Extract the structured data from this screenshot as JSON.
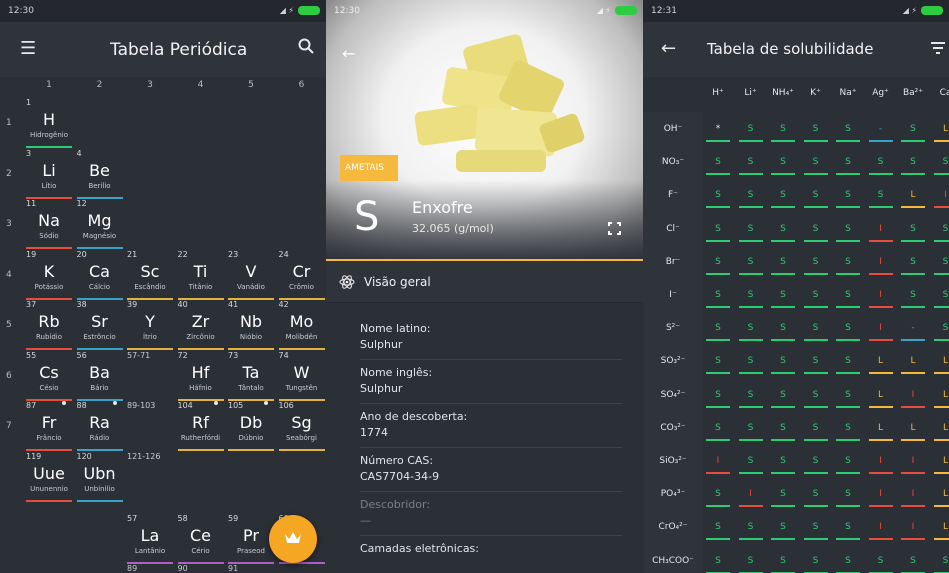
{
  "screen1": {
    "status": {
      "time": "12:30"
    },
    "appbar": {
      "title": "Tabela Periódica",
      "menu_icon": "menu-icon",
      "search_icon": "search-icon"
    },
    "columns": [
      "1",
      "2",
      "3",
      "4",
      "5",
      "6"
    ],
    "rows": [
      "1",
      "2",
      "3",
      "4",
      "5",
      "6",
      "7"
    ],
    "elements": [
      {
        "num": "1",
        "sym": "H",
        "name": "Hidrogênio",
        "col": 0,
        "row": 0,
        "color": "#2ecc71"
      },
      {
        "num": "3",
        "sym": "Li",
        "name": "Lítio",
        "col": 0,
        "row": 1,
        "color": "#e84c3d"
      },
      {
        "num": "4",
        "sym": "Be",
        "name": "Berílio",
        "col": 1,
        "row": 1,
        "color": "#3aa3c9"
      },
      {
        "num": "11",
        "sym": "Na",
        "name": "Sódio",
        "col": 0,
        "row": 2,
        "color": "#e84c3d"
      },
      {
        "num": "12",
        "sym": "Mg",
        "name": "Magnésio",
        "col": 1,
        "row": 2,
        "color": "#3aa3c9"
      },
      {
        "num": "19",
        "sym": "K",
        "name": "Potássio",
        "col": 0,
        "row": 3,
        "color": "#e84c3d"
      },
      {
        "num": "20",
        "sym": "Ca",
        "name": "Cálcio",
        "col": 1,
        "row": 3,
        "color": "#3aa3c9"
      },
      {
        "num": "21",
        "sym": "Sc",
        "name": "Escândio",
        "col": 2,
        "row": 3,
        "color": "#e3b341"
      },
      {
        "num": "22",
        "sym": "Ti",
        "name": "Titânio",
        "col": 3,
        "row": 3,
        "color": "#e3b341"
      },
      {
        "num": "23",
        "sym": "V",
        "name": "Vanádio",
        "col": 4,
        "row": 3,
        "color": "#e3b341"
      },
      {
        "num": "24",
        "sym": "Cr",
        "name": "Crômio",
        "col": 5,
        "row": 3,
        "color": "#e3b341"
      },
      {
        "num": "37",
        "sym": "Rb",
        "name": "Rubídio",
        "col": 0,
        "row": 4,
        "color": "#e84c3d"
      },
      {
        "num": "38",
        "sym": "Sr",
        "name": "Estrôncio",
        "col": 1,
        "row": 4,
        "color": "#3aa3c9"
      },
      {
        "num": "39",
        "sym": "Y",
        "name": "Ítrio",
        "col": 2,
        "row": 4,
        "color": "#e3b341"
      },
      {
        "num": "40",
        "sym": "Zr",
        "name": "Zircônio",
        "col": 3,
        "row": 4,
        "color": "#e3b341"
      },
      {
        "num": "41",
        "sym": "Nb",
        "name": "Nióbio",
        "col": 4,
        "row": 4,
        "color": "#e3b341"
      },
      {
        "num": "42",
        "sym": "Mo",
        "name": "Molibdên",
        "col": 5,
        "row": 4,
        "color": "#e3b341"
      },
      {
        "num": "55",
        "sym": "Cs",
        "name": "Césio",
        "col": 0,
        "row": 5,
        "color": "#e84c3d"
      },
      {
        "num": "56",
        "sym": "Ba",
        "name": "Bário",
        "col": 1,
        "row": 5,
        "color": "#3aa3c9"
      },
      {
        "num": "72",
        "sym": "Hf",
        "name": "Háfnio",
        "col": 3,
        "row": 5,
        "color": "#e3b341"
      },
      {
        "num": "73",
        "sym": "Ta",
        "name": "Tântalo",
        "col": 4,
        "row": 5,
        "color": "#e3b341"
      },
      {
        "num": "74",
        "sym": "W",
        "name": "Tungstên",
        "col": 5,
        "row": 5,
        "color": "#e3b341"
      },
      {
        "num": "87",
        "sym": "Fr",
        "name": "Frâncio",
        "col": 0,
        "row": 6,
        "color": "#e84c3d",
        "dot": true
      },
      {
        "num": "88",
        "sym": "Ra",
        "name": "Rádio",
        "col": 1,
        "row": 6,
        "color": "#3aa3c9",
        "dot": true
      },
      {
        "num": "104",
        "sym": "Rf",
        "name": "Rutherfórdi",
        "col": 3,
        "row": 6,
        "color": "#e3b341",
        "dot": true
      },
      {
        "num": "105",
        "sym": "Db",
        "name": "Dúbnio",
        "col": 4,
        "row": 6,
        "color": "#e3b341",
        "dot": true
      },
      {
        "num": "106",
        "sym": "Sg",
        "name": "Seabórgi",
        "col": 5,
        "row": 6,
        "color": "#e3b341"
      },
      {
        "num": "119",
        "sym": "Uue",
        "name": "Ununennio",
        "col": 0,
        "row": 7,
        "color": "#e84c3d"
      },
      {
        "num": "120",
        "sym": "Ubn",
        "name": "Unbinilio",
        "col": 1,
        "row": 7,
        "color": "#3aa3c9"
      },
      {
        "num": "57",
        "sym": "La",
        "name": "Lantânio",
        "col": 2,
        "row": 8,
        "color": "#b05fc7"
      },
      {
        "num": "58",
        "sym": "Ce",
        "name": "Cério",
        "col": 3,
        "row": 8,
        "color": "#b05fc7"
      },
      {
        "num": "59",
        "sym": "Pr",
        "name": "Praseod",
        "col": 4,
        "row": 8,
        "color": "#b05fc7"
      },
      {
        "num": "60",
        "sym": "d",
        "name": "mi",
        "col": 5,
        "row": 8,
        "color": "#b05fc7"
      }
    ],
    "ranges": [
      {
        "text": "57-71",
        "col": 2,
        "row": 5
      },
      {
        "text": "89-103",
        "col": 2,
        "row": 6
      },
      {
        "text": "121-126",
        "col": 2,
        "row": 7
      }
    ],
    "bottom_nums": [
      "89",
      "90",
      "91"
    ],
    "fab_icon": "crown-icon"
  },
  "screen2": {
    "status": {
      "time": "12:30"
    },
    "back_icon": "back-arrow-icon",
    "badge": "AMETAIS",
    "symbol": "S",
    "name": "Enxofre",
    "mass": "32.065 (g/mol)",
    "expand_icon": "fullscreen-icon",
    "section": {
      "icon": "atom-icon",
      "label": "Visão geral"
    },
    "props": [
      {
        "k": "Nome latino:",
        "v": "Sulphur"
      },
      {
        "k": "Nome inglês:",
        "v": "Sulphur"
      },
      {
        "k": "Ano de descoberta:",
        "v": "1774"
      },
      {
        "k": "Número CAS:",
        "v": "CAS7704-34-9"
      },
      {
        "k": "Descobridor:",
        "v": "—",
        "muted": true
      },
      {
        "k": "Camadas eletrônicas:",
        "v": "",
        "muted": false
      }
    ],
    "colors": {
      "accent": "#f5b93d"
    }
  },
  "screen3": {
    "status": {
      "time": "12:31"
    },
    "appbar": {
      "title": "Tabela de solubilidade",
      "back_icon": "back-arrow-icon",
      "filter_icon": "filter-icon"
    },
    "cations": [
      "H⁺",
      "Li⁺",
      "NH₄⁺",
      "K⁺",
      "Na⁺",
      "Ag⁺",
      "Ba²⁺",
      "Ca"
    ],
    "anions": [
      "OH⁻",
      "NO₃⁻",
      "F⁻",
      "Cl⁻",
      "Br⁻",
      "I⁻",
      "S²⁻",
      "SO₃²⁻",
      "SO₄²⁻",
      "CO₃²⁻",
      "SiO₃²⁻",
      "PO₄³⁻",
      "CrO₄²⁻",
      "CH₃COO⁻"
    ],
    "grid": [
      [
        "*",
        "S",
        "S",
        "S",
        "S",
        "-",
        "S",
        "L"
      ],
      [
        "S",
        "S",
        "S",
        "S",
        "S",
        "S",
        "S",
        "S"
      ],
      [
        "S",
        "S",
        "S",
        "S",
        "S",
        "S",
        "L",
        "I"
      ],
      [
        "S",
        "S",
        "S",
        "S",
        "S",
        "I",
        "S",
        "S"
      ],
      [
        "S",
        "S",
        "S",
        "S",
        "S",
        "I",
        "S",
        "S"
      ],
      [
        "S",
        "S",
        "S",
        "S",
        "S",
        "I",
        "S",
        "S"
      ],
      [
        "S",
        "S",
        "S",
        "S",
        "S",
        "I",
        "-",
        "S"
      ],
      [
        "S",
        "S",
        "S",
        "S",
        "S",
        "L",
        "L",
        "L"
      ],
      [
        "S",
        "S",
        "S",
        "S",
        "S",
        "L",
        "I",
        "L"
      ],
      [
        "S",
        "S",
        "S",
        "S",
        "S",
        "L",
        "L",
        "L"
      ],
      [
        "I",
        "S",
        "S",
        "S",
        "S",
        "I",
        "I",
        "L"
      ],
      [
        "S",
        "I",
        "S",
        "S",
        "S",
        "I",
        "I",
        "L"
      ],
      [
        "S",
        "S",
        "S",
        "S",
        "S",
        "I",
        "I",
        "L"
      ],
      [
        "S",
        "S",
        "S",
        "S",
        "S",
        "S",
        "S",
        "S"
      ]
    ],
    "colors": {
      "S": "#2ecc71",
      "I": "#e84c3d",
      "L": "#f5b93d",
      "-": "#3aa3c9",
      "*": "#e4e6e9"
    }
  }
}
